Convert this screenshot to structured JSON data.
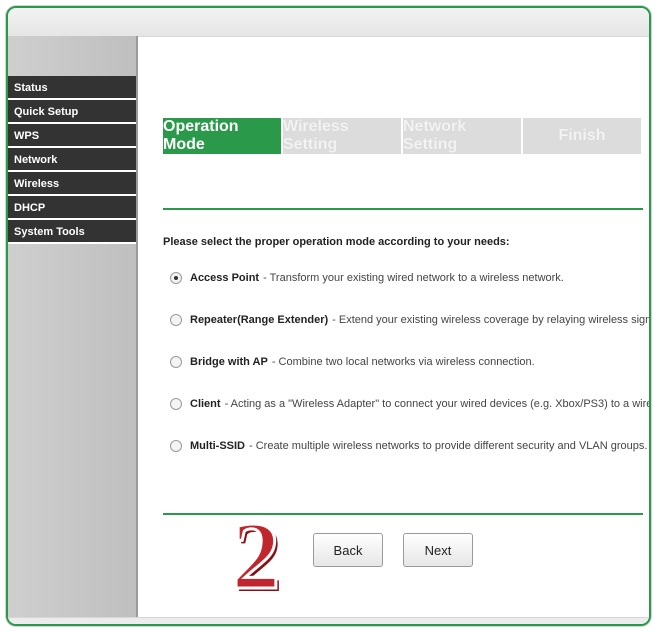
{
  "sidebar": {
    "items": [
      {
        "label": "Status"
      },
      {
        "label": "Quick Setup"
      },
      {
        "label": "WPS"
      },
      {
        "label": "Network"
      },
      {
        "label": "Wireless"
      },
      {
        "label": "DHCP"
      },
      {
        "label": "System Tools"
      }
    ]
  },
  "wizard": {
    "steps": [
      {
        "label": "Operation Mode",
        "active": true
      },
      {
        "label": "Wireless Setting",
        "active": false
      },
      {
        "label": "Network Setting",
        "active": false
      },
      {
        "label": "Finish",
        "active": false
      }
    ]
  },
  "main": {
    "prompt": "Please select the proper operation mode according to your needs:",
    "options": [
      {
        "title": "Access Point",
        "desc": "- Transform your existing wired network to a wireless network.",
        "checked": true
      },
      {
        "title": "Repeater(Range Extender)",
        "desc": "- Extend your existing wireless coverage by relaying wireless signal.",
        "checked": false
      },
      {
        "title": "Bridge with AP",
        "desc": "- Combine two local networks via wireless connection.",
        "checked": false
      },
      {
        "title": "Client",
        "desc": "- Acting as a \"Wireless Adapter\" to connect your wired devices (e.g. Xbox/PS3) to a wireless network.",
        "checked": false
      },
      {
        "title": "Multi-SSID",
        "desc": "- Create multiple wireless networks to provide different security and VLAN groups.",
        "checked": false
      }
    ]
  },
  "buttons": {
    "back": "Back",
    "next": "Next"
  },
  "overlay": {
    "step_number": "2"
  },
  "colors": {
    "accent": "#2a9a4a",
    "sidebar_item_bg": "#333333",
    "step_inactive_bg": "#dcdcdc",
    "stamp": "#c0262d"
  }
}
